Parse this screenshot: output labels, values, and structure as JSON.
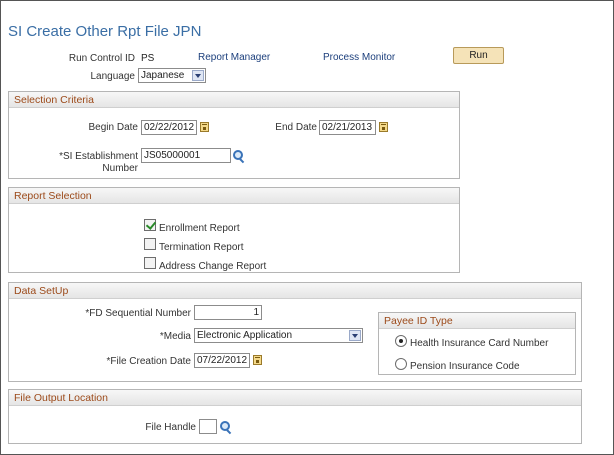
{
  "page": {
    "title": "SI Create Other Rpt File JPN"
  },
  "header": {
    "run_control_label": "Run Control ID",
    "run_control_value": "PS",
    "report_manager_link": "Report Manager",
    "process_monitor_link": "Process Monitor",
    "run_button": "Run",
    "language_label": "Language",
    "language_value": "Japanese"
  },
  "selection_criteria": {
    "title": "Selection Criteria",
    "begin_date_label": "Begin Date",
    "begin_date_value": "02/22/2012",
    "end_date_label": "End Date",
    "end_date_value": "02/21/2013",
    "establishment_label_line1": "*SI Establishment",
    "establishment_label_line2": "Number",
    "establishment_value": "JS05000001"
  },
  "report_selection": {
    "title": "Report Selection",
    "options": [
      {
        "label": "Enrollment Report",
        "checked": true
      },
      {
        "label": "Termination Report",
        "checked": false
      },
      {
        "label": "Address Change Report",
        "checked": false
      }
    ]
  },
  "data_setup": {
    "title": "Data SetUp",
    "fd_seq_label": "*FD Sequential Number",
    "fd_seq_value": "1",
    "media_label": "*Media",
    "media_value": "Electronic Application",
    "file_date_label": "*File Creation Date",
    "file_date_value": "07/22/2012",
    "payee": {
      "title": "Payee ID Type",
      "options": [
        {
          "label": "Health Insurance Card Number",
          "selected": true
        },
        {
          "label": "Pension Insurance Code",
          "selected": false
        }
      ]
    }
  },
  "file_output": {
    "title": "File Output Location",
    "file_handle_label": "File Handle",
    "file_handle_value": ""
  },
  "colors": {
    "title": "#3a6ea5",
    "section_title": "#9c4a1a",
    "link": "#1c3f7c",
    "run_button_bg": "#f5e3b8"
  }
}
